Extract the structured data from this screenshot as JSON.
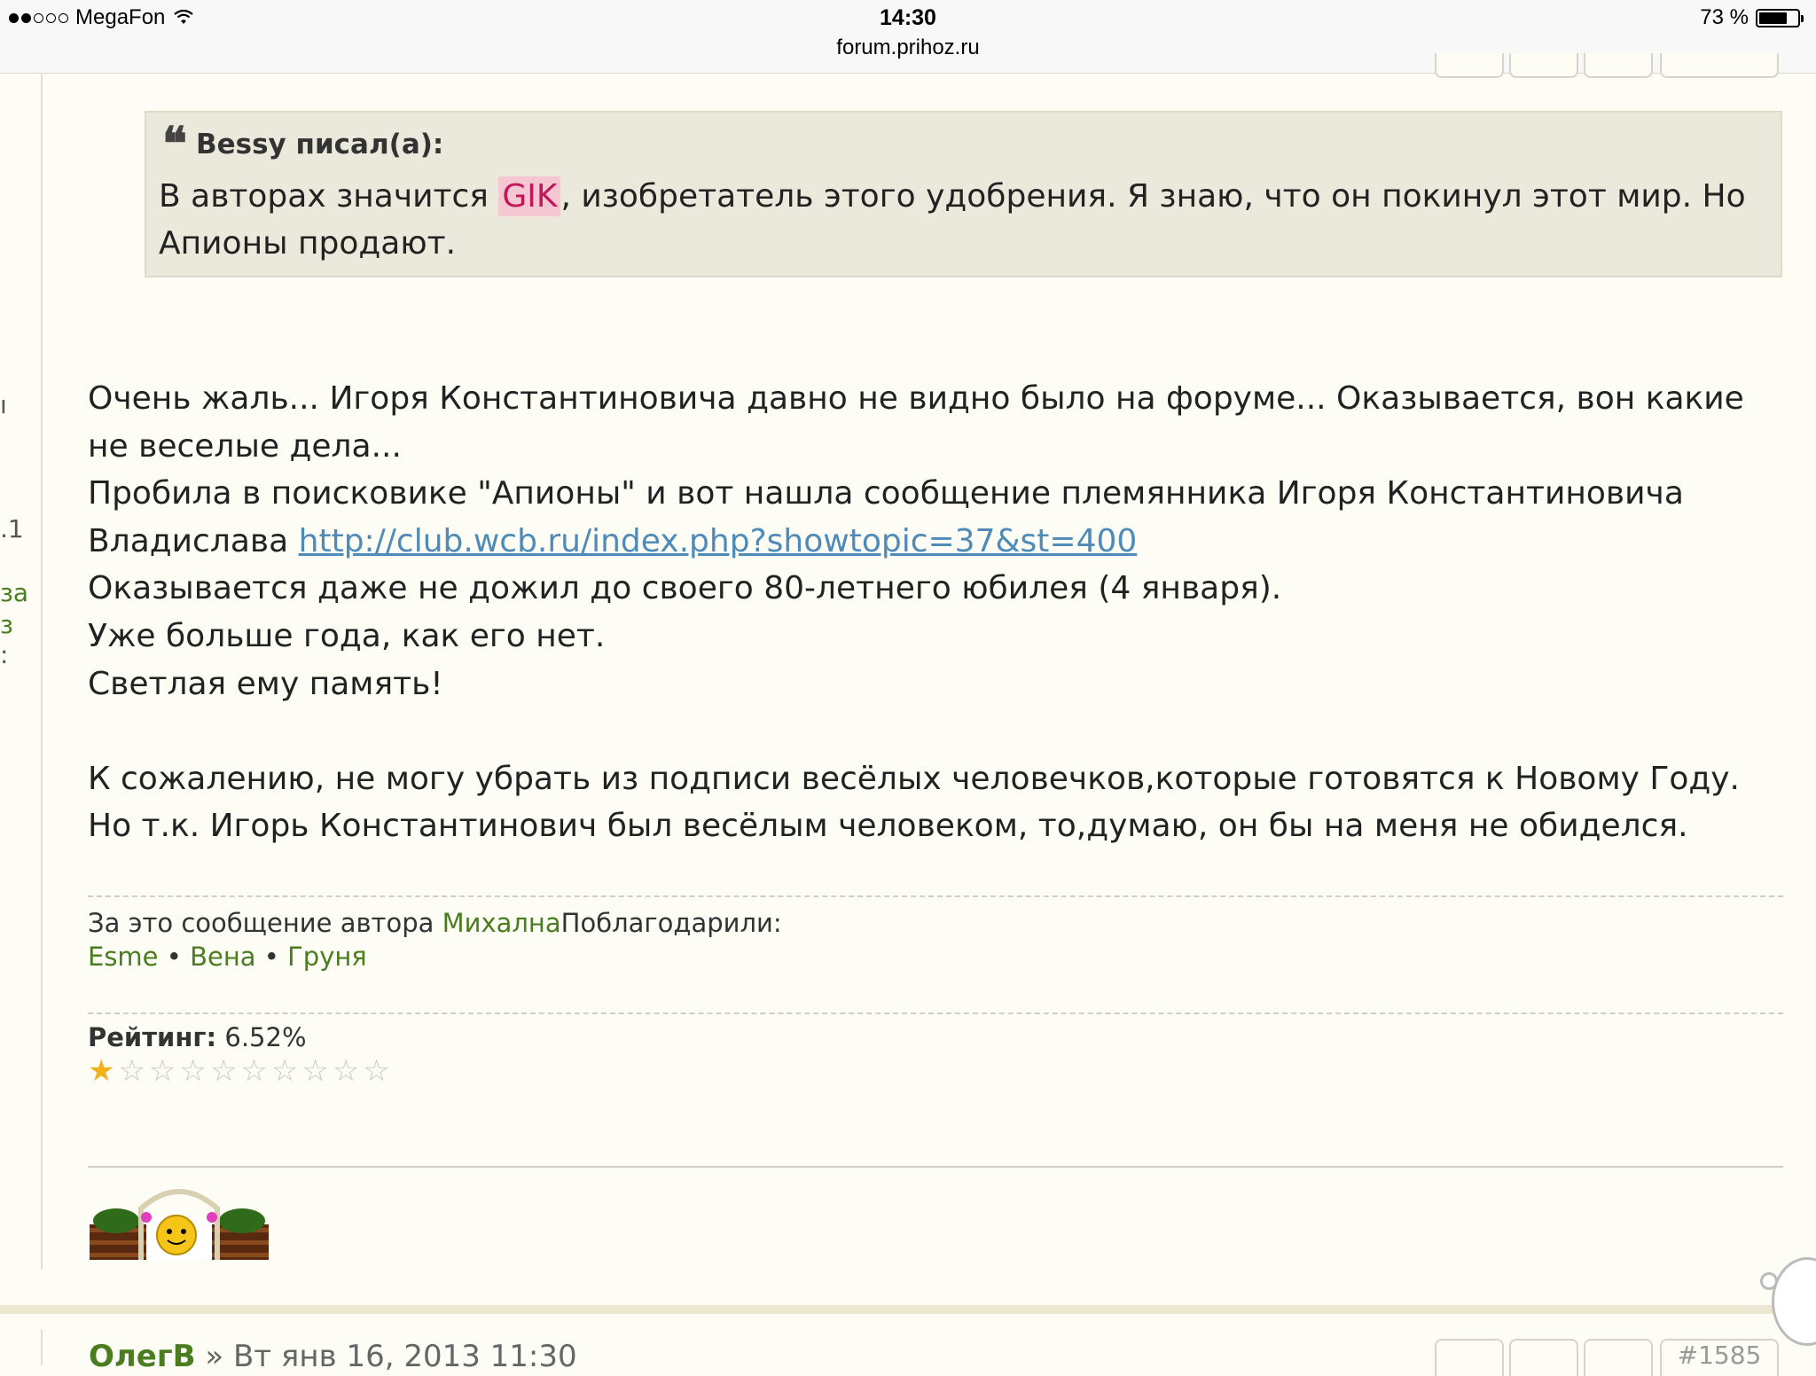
{
  "status_bar": {
    "carrier": "MegaFon",
    "time": "14:30",
    "url": "forum.prihoz.ru",
    "battery": "73 %",
    "battery_level": 0.73,
    "signal_bars_filled": 2,
    "signal_bars_total": 5
  },
  "left_edge": {
    "frag1": "ı",
    "frag2": ".1",
    "frag3": "за",
    "frag4": "з",
    "frag5": ":"
  },
  "quote": {
    "author_header": "Bessy писал(а):",
    "text_before": "В авторах значится ",
    "highlight": "GIK",
    "text_after": ", изобретатель этого удобрения. Я знаю, что он покинул этот мир. Но Апионы продают."
  },
  "post": {
    "line1": "Очень жаль... Игоря Константиновича давно не видно было на форуме... Оказывается, вон какие не веселые дела...",
    "line2": "Пробила в поисковике \"Апионы\" и вот нашла сообщение племянника Игоря Константиновича",
    "line3_prefix": "Владислава ",
    "link": "http://club.wcb.ru/index.php?showtopic=37&st=400",
    "line4": "Оказывается даже не дожил до своего 80-летнего юбилея (4 января).",
    "line5": "Уже больше года, как его нет.",
    "line6": "Светлая ему память!",
    "line7": "К сожалению, не могу убрать из подписи весёлых человечков,которые готовятся к Новому Году.",
    "line8": "Но т.к. Игорь Константинович был весёлым человеком, то,думаю, он бы на меня не обиделся."
  },
  "thanks": {
    "prefix": "За это сообщение автора ",
    "author": "Михална",
    "suffix": "Поблагодарили:",
    "users": [
      "Esme",
      "Вена",
      "Груня"
    ],
    "separator": " • "
  },
  "rating": {
    "label": "Рейтинг:",
    "value": "6.52%",
    "stars_filled": 1,
    "stars_total": 10
  },
  "next_post": {
    "author_partial": "ОлегВ",
    "date_partial": "Вт янв 16, 2013 11:30",
    "post_number_partial": "#1585"
  },
  "icons": [
    "wifi-icon",
    "battery-icon",
    "quote-icon",
    "star-icon",
    "signature-image",
    "scroll-to-top-icon"
  ],
  "colors": {
    "background": "#fdfcf5",
    "quote_bg": "#ebe9dc",
    "link": "#4e8bb8",
    "username_green": "#4a7d1f",
    "highlight_bg": "#f4c7d2",
    "highlight_text": "#c2185b",
    "star": "#f0b21c"
  }
}
